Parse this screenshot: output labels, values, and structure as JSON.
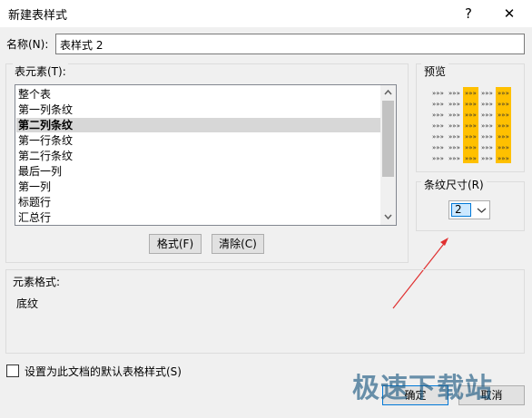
{
  "dialog": {
    "title": "新建表样式",
    "help_glyph": "?",
    "close_glyph": "✕"
  },
  "name_field": {
    "label": "名称(N):",
    "value": "表样式 2"
  },
  "elements": {
    "label": "表元素(T):",
    "items": [
      "整个表",
      "第一列条纹",
      "第二列条纹",
      "第一行条纹",
      "第二行条纹",
      "最后一列",
      "第一列",
      "标题行",
      "汇总行"
    ],
    "selected_index": 2
  },
  "buttons": {
    "format": "格式(F)",
    "clear": "清除(C)",
    "ok": "确定",
    "cancel": "取消"
  },
  "preview": {
    "label": "预览",
    "mark": "»»»",
    "highlight_color": "#ffc000"
  },
  "stripe_size": {
    "label": "条纹尺寸(R)",
    "value": "2"
  },
  "element_format": {
    "label": "元素格式:",
    "value": "底纹"
  },
  "default_checkbox": {
    "label": "设置为此文档的默认表格样式(S)",
    "checked": false
  },
  "watermark": {
    "text": "极速下载站"
  }
}
